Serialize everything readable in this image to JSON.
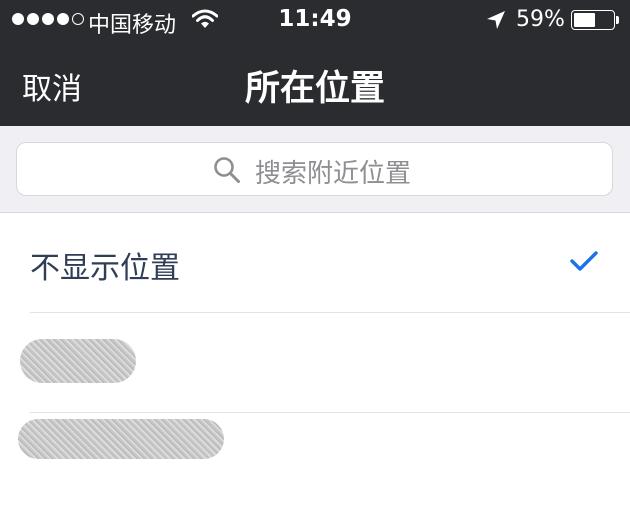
{
  "status_bar": {
    "carrier": "中国移动",
    "time": "11:49",
    "battery_percent": "59%",
    "battery_level": 0.59,
    "signal_bars_filled": 4,
    "signal_bars_total": 5,
    "icons": [
      "wifi-icon",
      "location-arrow-icon",
      "battery-icon"
    ]
  },
  "nav": {
    "cancel_label": "取消",
    "title": "所在位置"
  },
  "search": {
    "placeholder": "搜索附近位置",
    "icon": "search-icon"
  },
  "locations": [
    {
      "label": "不显示位置",
      "selected": true
    },
    {
      "label": "",
      "selected": false
    },
    {
      "label": "",
      "selected": false
    }
  ],
  "colors": {
    "nav_background": "#2b2c30",
    "search_background": "#efeff4",
    "checkmark": "#1a73e8",
    "row_text": "#2f3d56"
  }
}
